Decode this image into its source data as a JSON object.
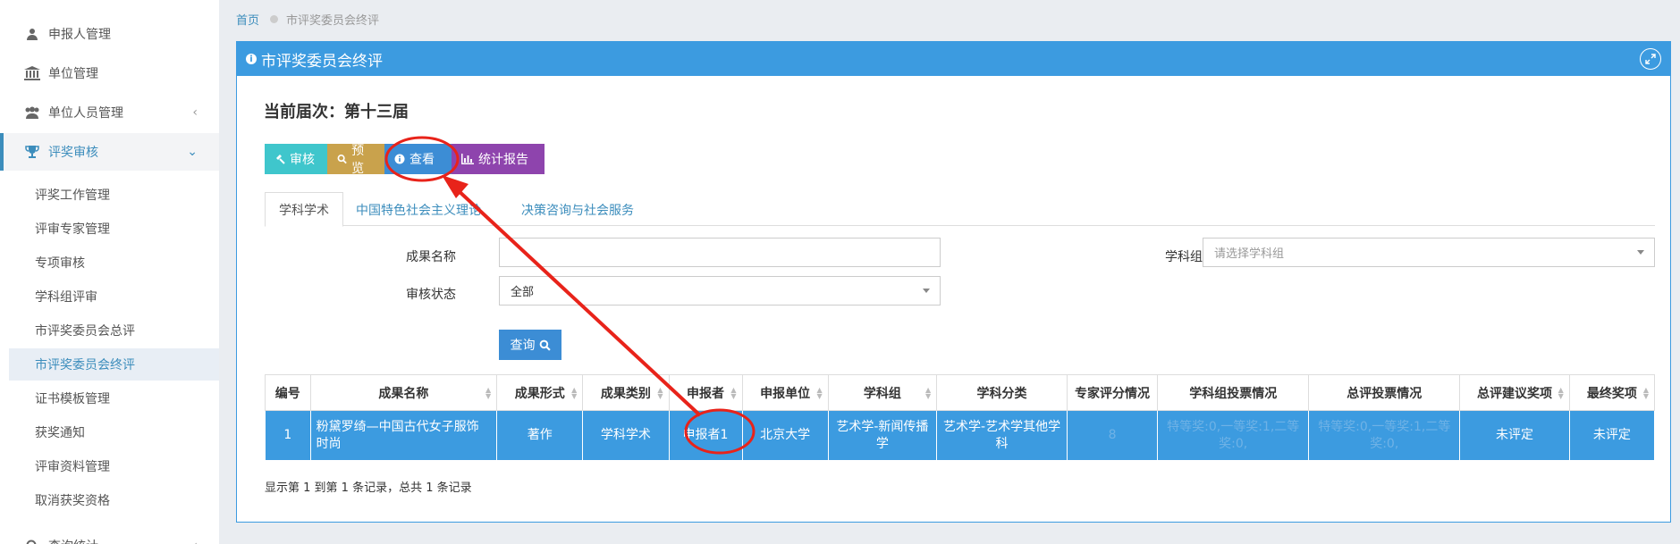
{
  "sidebar": {
    "items": [
      {
        "label": "申报人管理",
        "icon": "user-icon"
      },
      {
        "label": "单位管理",
        "icon": "bank-icon"
      },
      {
        "label": "单位人员管理",
        "icon": "users-icon",
        "arrow": "‹"
      },
      {
        "label": "评奖审核",
        "icon": "trophy-icon",
        "arrow": "⌄"
      }
    ],
    "subitems": [
      "评奖工作管理",
      "评审专家管理",
      "专项审核",
      "学科组评审",
      "市评奖委员会总评",
      "市评奖委员会终评",
      "证书模板管理",
      "获奖通知",
      "评审资料管理",
      "取消获奖资格"
    ],
    "bottom_item": {
      "label": "查询统计",
      "icon": "search-icon",
      "arrow": "‹"
    }
  },
  "breadcrumb": {
    "home": "首页",
    "current": "市评奖委员会终评"
  },
  "panel": {
    "title": "市评奖委员会终评"
  },
  "term": "当前届次：第十三届",
  "buttons": {
    "review": "审核",
    "preview": "预览",
    "view": "查看",
    "report": "统计报告"
  },
  "tabs": [
    "学科学术",
    "中国特色社会主义理论",
    "决策咨询与社会服务"
  ],
  "form": {
    "name_label": "成果名称",
    "name_value": "",
    "status_label": "审核状态",
    "status_value": "全部",
    "group_label": "学科组",
    "group_placeholder": "请选择学科组",
    "query_label": "查询"
  },
  "table": {
    "headers": [
      "编号",
      "成果名称",
      "成果形式",
      "成果类别",
      "申报者",
      "申报单位",
      "学科组",
      "学科分类",
      "专家评分情况",
      "学科组投票情况",
      "总评投票情况",
      "总评建议奖项",
      "最终奖项"
    ],
    "rows": [
      [
        "1",
        "粉黛罗绮—中国古代女子服饰时尚",
        "著作",
        "学科学术",
        "申报者1",
        "北京大学",
        "艺术学-新闻传播学",
        "艺术学-艺术学其他学科",
        "8",
        "特等奖:0,一等奖:1,二等奖:0,",
        "特等奖:0,一等奖:1,二等奖:0,",
        "未评定",
        "未评定"
      ]
    ]
  },
  "footer": "显示第 1 到第 1 条记录，总共 1 条记录",
  "colors": {
    "primary": "#3c9be0",
    "annotation": "#e8231a"
  }
}
